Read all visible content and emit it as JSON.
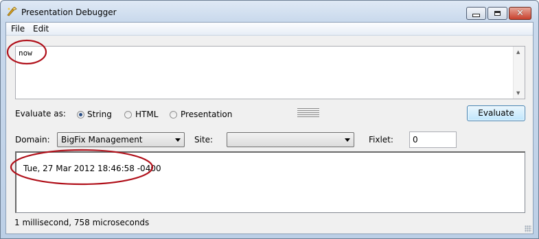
{
  "window": {
    "title": "Presentation Debugger",
    "controls": {
      "minimize_icon": "minimize-icon",
      "maximize_icon": "maximize-icon",
      "close_icon": "close-icon",
      "close_glyph": "✕"
    }
  },
  "menu": {
    "file": "File",
    "edit": "Edit"
  },
  "expression": {
    "value": "now"
  },
  "evaluate_as": {
    "label": "Evaluate as:",
    "options": [
      "String",
      "HTML",
      "Presentation"
    ],
    "selected": "String"
  },
  "evaluate_button": "Evaluate",
  "domain": {
    "label": "Domain:",
    "value": "BigFix Management"
  },
  "site": {
    "label": "Site:",
    "value": ""
  },
  "fixlet": {
    "label": "Fixlet:",
    "value": "0"
  },
  "result": {
    "text": "Tue, 27 Mar 2012 18:46:58 -0400"
  },
  "status": {
    "text": "1 millisecond, 758 microseconds"
  },
  "colors": {
    "annotation": "#b0101a",
    "button_border": "#3c7fb1",
    "radio_dot": "#2c4f86"
  }
}
